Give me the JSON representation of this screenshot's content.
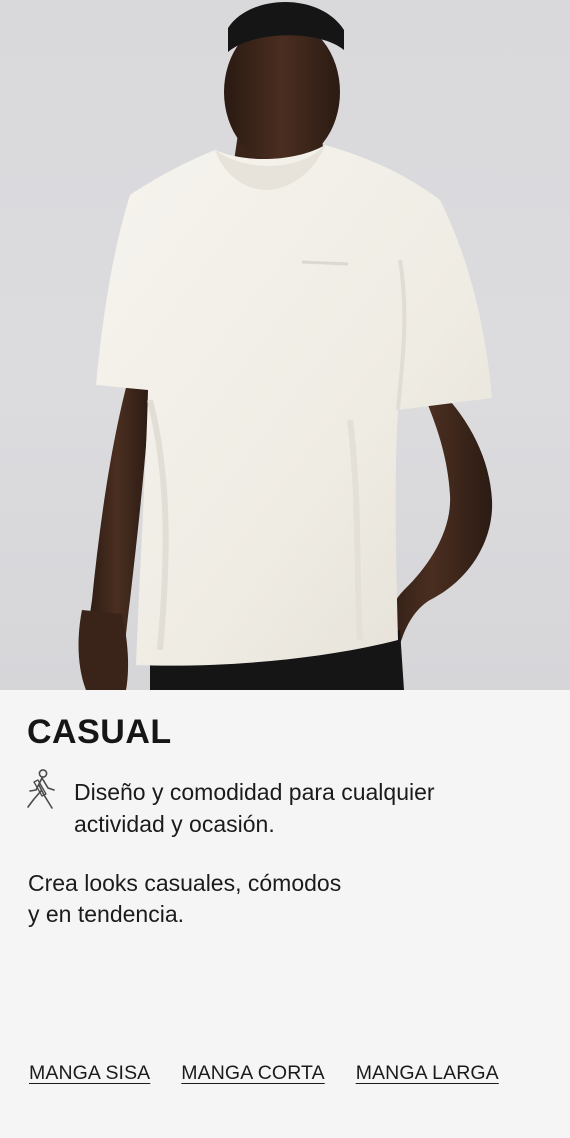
{
  "hero": {
    "icon": "model-photo",
    "background_color": "#dadadd",
    "shirt_color": "#f2efe8"
  },
  "section": {
    "title": "CASUAL",
    "feature_icon": "walking-person-icon",
    "feature_text_line1": "Diseño y comodidad para cualquier",
    "feature_text_line2": "actividad y ocasión.",
    "tagline_line1": "Crea looks casuales, cómodos",
    "tagline_line2": "y en tendencia."
  },
  "links": [
    {
      "label": "MANGA SISA"
    },
    {
      "label": "MANGA CORTA"
    },
    {
      "label": "MANGA LARGA"
    }
  ]
}
